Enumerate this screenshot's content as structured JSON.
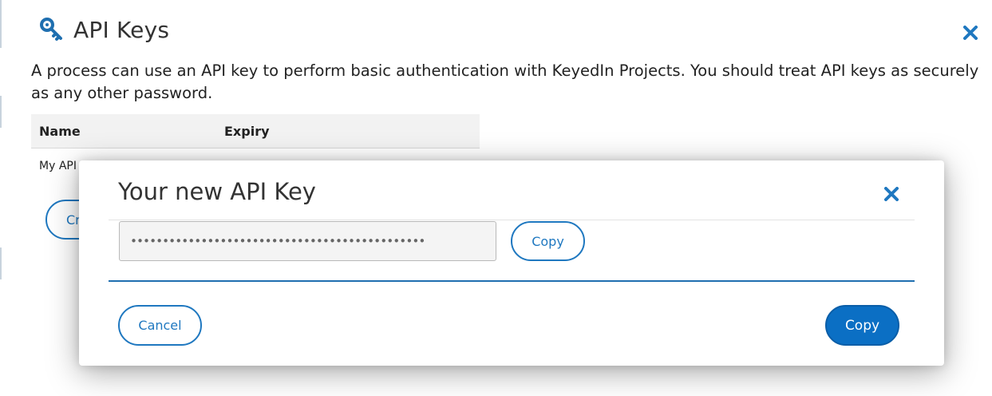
{
  "panel": {
    "title": "API Keys",
    "description": "A process can use an API key to perform basic authentication with KeyedIn Projects. You should treat API keys as securely as any other password.",
    "table": {
      "columns": [
        "Name",
        "Expiry"
      ],
      "rows": [
        {
          "name": "My API",
          "expiry": ""
        }
      ]
    },
    "create_button_label": "Cr",
    "icons": {
      "title_icon": "key-icon",
      "close": "close-icon"
    }
  },
  "modal": {
    "title": "Your new API Key",
    "key_value": "••••••••••••••••••••••••••••••••••••••••••••••",
    "inline_copy_label": "Copy",
    "cancel_label": "Cancel",
    "copy_label": "Copy",
    "icons": {
      "close": "close-icon"
    }
  },
  "colors": {
    "accent": "#1f78c0",
    "primary_button": "#0b6fc4",
    "divider": "#1f6fb0"
  }
}
